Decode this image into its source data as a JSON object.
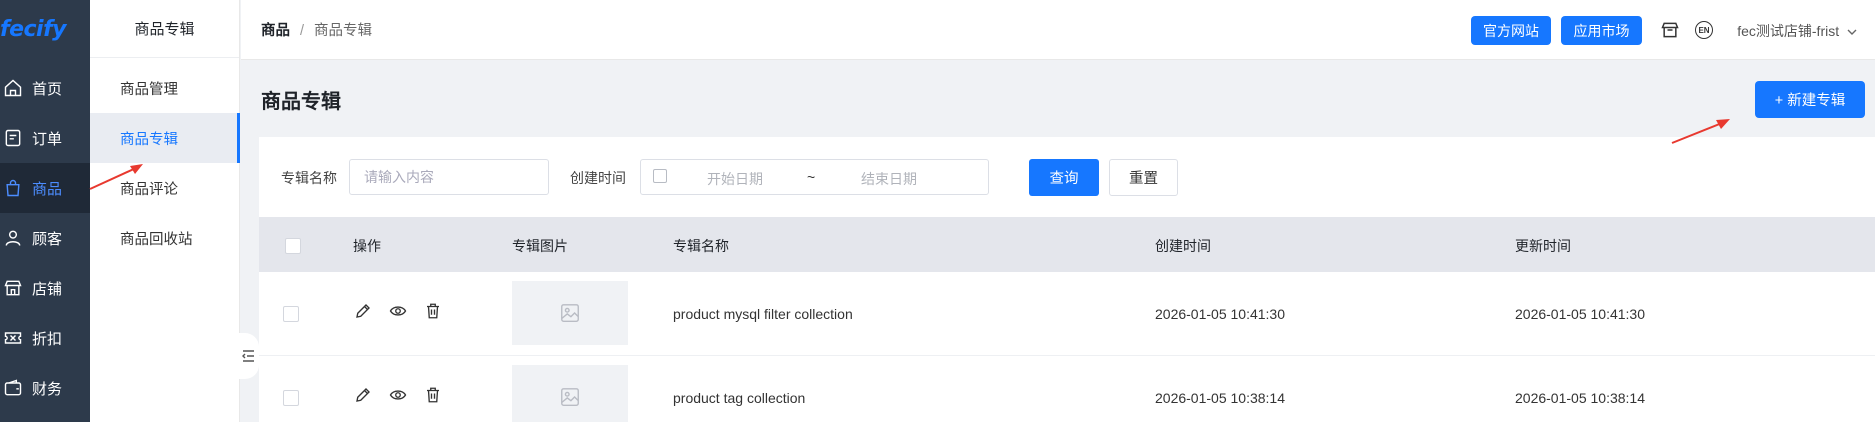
{
  "brand": {
    "logo_text": "fecify",
    "accent": "#1677ff",
    "nav_bg": "#2d3a4b"
  },
  "nav": {
    "items": [
      {
        "label": "首页",
        "icon": "home-icon"
      },
      {
        "label": "订单",
        "icon": "order-icon"
      },
      {
        "label": "商品",
        "icon": "bag-icon",
        "active": true
      },
      {
        "label": "顾客",
        "icon": "user-icon"
      },
      {
        "label": "店铺",
        "icon": "store-icon"
      },
      {
        "label": "折扣",
        "icon": "coupon-icon"
      },
      {
        "label": "财务",
        "icon": "wallet-icon"
      }
    ]
  },
  "submenu": {
    "title": "商品专辑",
    "items": [
      {
        "label": "商品管理"
      },
      {
        "label": "商品专辑",
        "active": true
      },
      {
        "label": "商品评论"
      },
      {
        "label": "商品回收站"
      }
    ]
  },
  "header": {
    "breadcrumb": {
      "root": "商品",
      "sep": "/",
      "current": "商品专辑"
    },
    "official_site": "官方网站",
    "app_market": "应用市场",
    "lang": "EN",
    "shop_name": "fec测试店铺-frist"
  },
  "page": {
    "title": "商品专辑",
    "new_button": "+ 新建专辑"
  },
  "filter": {
    "name_label": "专辑名称",
    "name_placeholder": "请输入内容",
    "time_label": "创建时间",
    "start_placeholder": "开始日期",
    "range_sep": "~",
    "end_placeholder": "结束日期",
    "search_button": "查询",
    "reset_button": "重置"
  },
  "table": {
    "columns": [
      "操作",
      "专辑图片",
      "专辑名称",
      "创建时间",
      "更新时间"
    ],
    "rows": [
      {
        "name": "product mysql filter collection",
        "created": "2026-01-05 10:41:30",
        "updated": "2026-01-05 10:41:30"
      },
      {
        "name": "product tag collection",
        "created": "2026-01-05 10:38:14",
        "updated": "2026-01-05 10:38:14"
      }
    ]
  }
}
